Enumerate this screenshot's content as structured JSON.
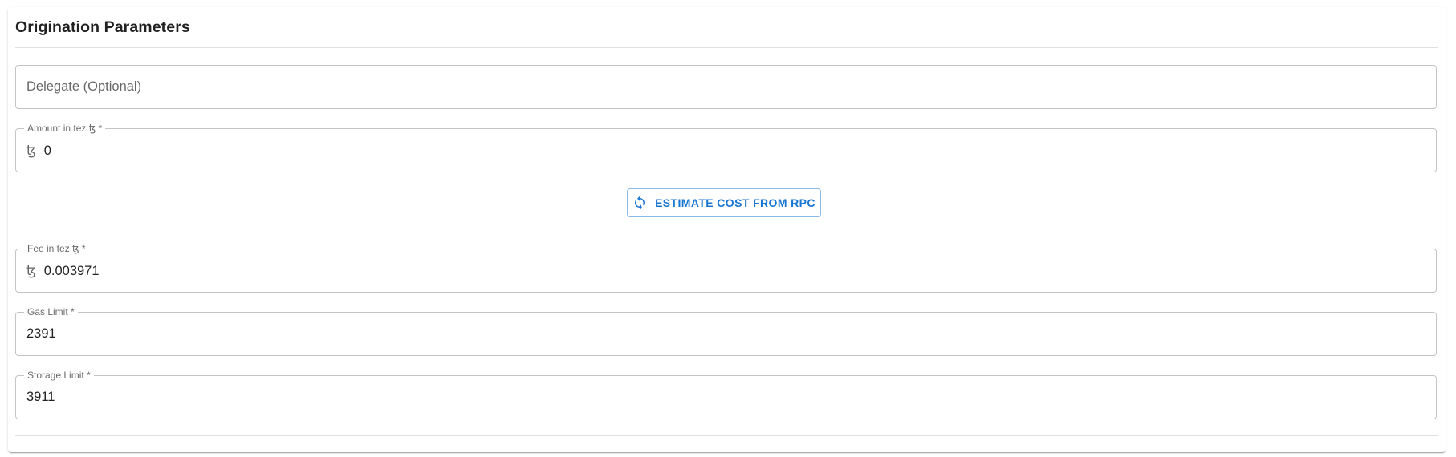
{
  "card": {
    "title": "Origination Parameters"
  },
  "fields": {
    "delegate": {
      "placeholder": "Delegate (Optional)"
    },
    "amount": {
      "label": "Amount in tez ꜩ *",
      "currency_symbol": "ꜩ",
      "value": "0"
    },
    "fee": {
      "label": "Fee in tez ꜩ *",
      "currency_symbol": "ꜩ",
      "value": "0.003971"
    },
    "gas_limit": {
      "label": "Gas Limit *",
      "value": "2391"
    },
    "storage_limit": {
      "label": "Storage Limit *",
      "value": "3911"
    }
  },
  "estimate_button": {
    "label": "ESTIMATE COST FROM RPC",
    "icon": "refresh-icon"
  },
  "colors": {
    "primary": "#1976d2",
    "border": "#c4c4c4",
    "divider": "#e0e0e0"
  }
}
